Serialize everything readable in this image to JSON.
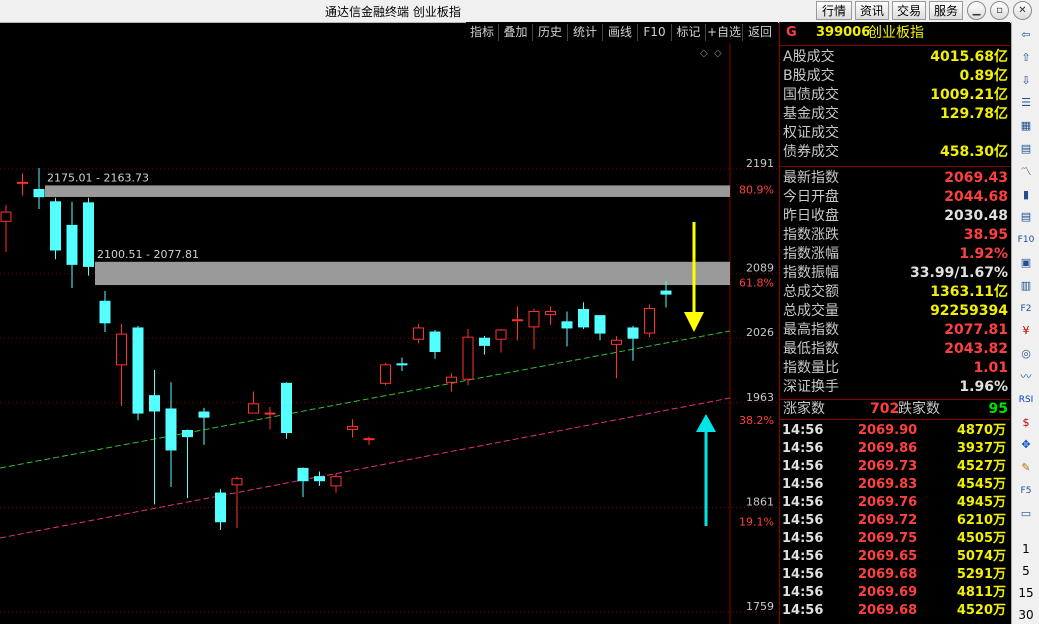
{
  "window": {
    "title": "通达信金融终端  创业板指",
    "menu": [
      "行情",
      "资讯",
      "交易",
      "服务"
    ]
  },
  "toolbar": [
    "指标",
    "叠加",
    "历史",
    "统计",
    "画线",
    "F10",
    "标记",
    "+自选",
    "返回"
  ],
  "chart_data": {
    "type": "candlestick",
    "ylim": [
      1759,
      2191
    ],
    "price_ticks": [
      2191,
      2089,
      2026,
      1963,
      1861,
      1759
    ],
    "fib_labels": [
      "80.9%",
      "61.8%",
      "38.2%",
      "19.1%"
    ],
    "zones": [
      {
        "label": "2175.01 - 2163.73",
        "low": 2163.73,
        "high": 2175.01
      },
      {
        "label": "2100.51 - 2077.81",
        "low": 2077.81,
        "high": 2100.51
      }
    ],
    "candles": [
      {
        "o": 2140,
        "c": 2149,
        "h": 2156,
        "l": 2110
      },
      {
        "o": 2178,
        "c": 2178,
        "h": 2187,
        "l": 2165
      },
      {
        "o": 2171,
        "c": 2164,
        "h": 2192,
        "l": 2152
      },
      {
        "o": 2159,
        "c": 2112,
        "h": 2163,
        "l": 2103
      },
      {
        "o": 2136,
        "c": 2098,
        "h": 2159,
        "l": 2075
      },
      {
        "o": 2158,
        "c": 2096,
        "h": 2163,
        "l": 2087
      },
      {
        "o": 2062,
        "c": 2041,
        "h": 2072,
        "l": 2032
      },
      {
        "o": 2000,
        "c": 2030,
        "h": 2040,
        "l": 1960
      },
      {
        "o": 2036,
        "c": 1953,
        "h": 2038,
        "l": 1946
      },
      {
        "o": 1970,
        "c": 1955,
        "h": 1995,
        "l": 1864
      },
      {
        "o": 1957,
        "c": 1917,
        "h": 1983,
        "l": 1881
      },
      {
        "o": 1936,
        "c": 1930,
        "h": 1937,
        "l": 1870
      },
      {
        "o": 1954,
        "c": 1949,
        "h": 1958,
        "l": 1922
      },
      {
        "o": 1875,
        "c": 1847,
        "h": 1879,
        "l": 1839
      },
      {
        "o": 1883,
        "c": 1889,
        "h": 1891,
        "l": 1841
      },
      {
        "o": 1953,
        "c": 1962,
        "h": 1974,
        "l": 1953
      },
      {
        "o": 1953,
        "c": 1953,
        "h": 1959,
        "l": 1937
      },
      {
        "o": 1982,
        "c": 1934,
        "h": 1983,
        "l": 1928
      },
      {
        "o": 1899,
        "c": 1887,
        "h": 1900,
        "l": 1871
      },
      {
        "o": 1891,
        "c": 1887,
        "h": 1896,
        "l": 1882
      },
      {
        "o": 1882,
        "c": 1891,
        "h": 1894,
        "l": 1875
      },
      {
        "o": 1937,
        "c": 1940,
        "h": 1947,
        "l": 1929
      },
      {
        "o": 1928,
        "c": 1928,
        "h": 1930,
        "l": 1922
      },
      {
        "o": 1982,
        "c": 2000,
        "h": 2002,
        "l": 1980
      },
      {
        "o": 2001,
        "c": 2000,
        "h": 2007,
        "l": 1994
      },
      {
        "o": 2025,
        "c": 2036,
        "h": 2040,
        "l": 2021
      },
      {
        "o": 2032,
        "c": 2013,
        "h": 2034,
        "l": 2006
      },
      {
        "o": 1983,
        "c": 1988,
        "h": 1992,
        "l": 1974
      },
      {
        "o": 1986,
        "c": 2027,
        "h": 2035,
        "l": 1980
      },
      {
        "o": 2026,
        "c": 2019,
        "h": 2028,
        "l": 2010
      },
      {
        "o": 2025,
        "c": 2034,
        "h": 2035,
        "l": 2012
      },
      {
        "o": 2044,
        "c": 2044,
        "h": 2057,
        "l": 2024
      },
      {
        "o": 2037,
        "c": 2052,
        "h": 2055,
        "l": 2015
      },
      {
        "o": 2049,
        "c": 2052,
        "h": 2057,
        "l": 2039
      },
      {
        "o": 2042,
        "c": 2036,
        "h": 2052,
        "l": 2018
      },
      {
        "o": 2054,
        "c": 2037,
        "h": 2061,
        "l": 2035
      },
      {
        "o": 2048,
        "c": 2031,
        "h": 2048,
        "l": 2024
      },
      {
        "o": 2020,
        "c": 2024,
        "h": 2028,
        "l": 1987
      },
      {
        "o": 2036,
        "c": 2026,
        "h": 2038,
        "l": 2004
      },
      {
        "o": 2031,
        "c": 2055,
        "h": 2059,
        "l": 2027
      },
      {
        "o": 2072,
        "c": 2069,
        "h": 2081,
        "l": 2056
      }
    ]
  },
  "quote": {
    "header_code": "G",
    "code": "399006",
    "name": "创业板指",
    "rows": [
      {
        "label": "A股成交",
        "value": "4015.68亿",
        "color": "#f0f000"
      },
      {
        "label": "B股成交",
        "value": "0.89亿",
        "color": "#f0f000"
      },
      {
        "label": "国债成交",
        "value": "1009.21亿",
        "color": "#f0f000"
      },
      {
        "label": "基金成交",
        "value": "129.78亿",
        "color": "#f0f000"
      },
      {
        "label": "权证成交",
        "value": "",
        "color": "#f0f000"
      },
      {
        "label": "债券成交",
        "value": "458.30亿",
        "color": "#f0f000"
      }
    ],
    "rows2": [
      {
        "label": "最新指数",
        "value": "2069.43",
        "color": "#ff4040"
      },
      {
        "label": "今日开盘",
        "value": "2044.68",
        "color": "#ff4040"
      },
      {
        "label": "昨日收盘",
        "value": "2030.48",
        "color": "#e0e0e0"
      },
      {
        "label": "指数涨跌",
        "value": "38.95",
        "color": "#ff4040"
      },
      {
        "label": "指数涨幅",
        "value": "1.92%",
        "color": "#ff4040"
      },
      {
        "label": "指数振幅",
        "value": "33.99/1.67%",
        "color": "#e0e0e0"
      },
      {
        "label": "总成交额",
        "value": "1363.11亿",
        "color": "#f0f000"
      },
      {
        "label": "总成交量",
        "value": "92259394",
        "color": "#f0f000"
      },
      {
        "label": "最高指数",
        "value": "2077.81",
        "color": "#ff4040"
      },
      {
        "label": "最低指数",
        "value": "2043.82",
        "color": "#ff4040"
      },
      {
        "label": "指数量比",
        "value": "1.01",
        "color": "#ff4040"
      },
      {
        "label": "深证换手",
        "value": "1.96%",
        "color": "#e0e0e0"
      }
    ],
    "up_label": "涨家数",
    "up_count": "702",
    "down_label": "跌家数",
    "down_count": "95",
    "ticks": [
      {
        "time": "14:56",
        "price": "2069.90",
        "vol": "4870万"
      },
      {
        "time": "14:56",
        "price": "2069.86",
        "vol": "3937万"
      },
      {
        "time": "14:56",
        "price": "2069.73",
        "vol": "4527万"
      },
      {
        "time": "14:56",
        "price": "2069.83",
        "vol": "4545万"
      },
      {
        "time": "14:56",
        "price": "2069.76",
        "vol": "4945万"
      },
      {
        "time": "14:56",
        "price": "2069.72",
        "vol": "6210万"
      },
      {
        "time": "14:56",
        "price": "2069.75",
        "vol": "4505万"
      },
      {
        "time": "14:56",
        "price": "2069.65",
        "vol": "5074万"
      },
      {
        "time": "14:56",
        "price": "2069.68",
        "vol": "5291万"
      },
      {
        "time": "14:56",
        "price": "2069.69",
        "vol": "4811万"
      },
      {
        "time": "14:56",
        "price": "2069.68",
        "vol": "4520万"
      }
    ]
  },
  "sidebar": {
    "icons": [
      "arrow-left-icon",
      "arrow-up-icon",
      "arrow-down-icon",
      "list-icon",
      "table-icon",
      "grid-icon",
      "chart-icon",
      "bars-icon",
      "book-icon",
      "f10-icon",
      "report-icon",
      "news-icon",
      "f2-icon",
      "money-icon",
      "circle-icon",
      "line-chart-icon",
      "rsi-icon",
      "dollar-icon",
      "move-icon",
      "pen-icon",
      "f5-icon",
      "window-icon"
    ],
    "periods": [
      "1",
      "5",
      "15",
      "30"
    ]
  }
}
